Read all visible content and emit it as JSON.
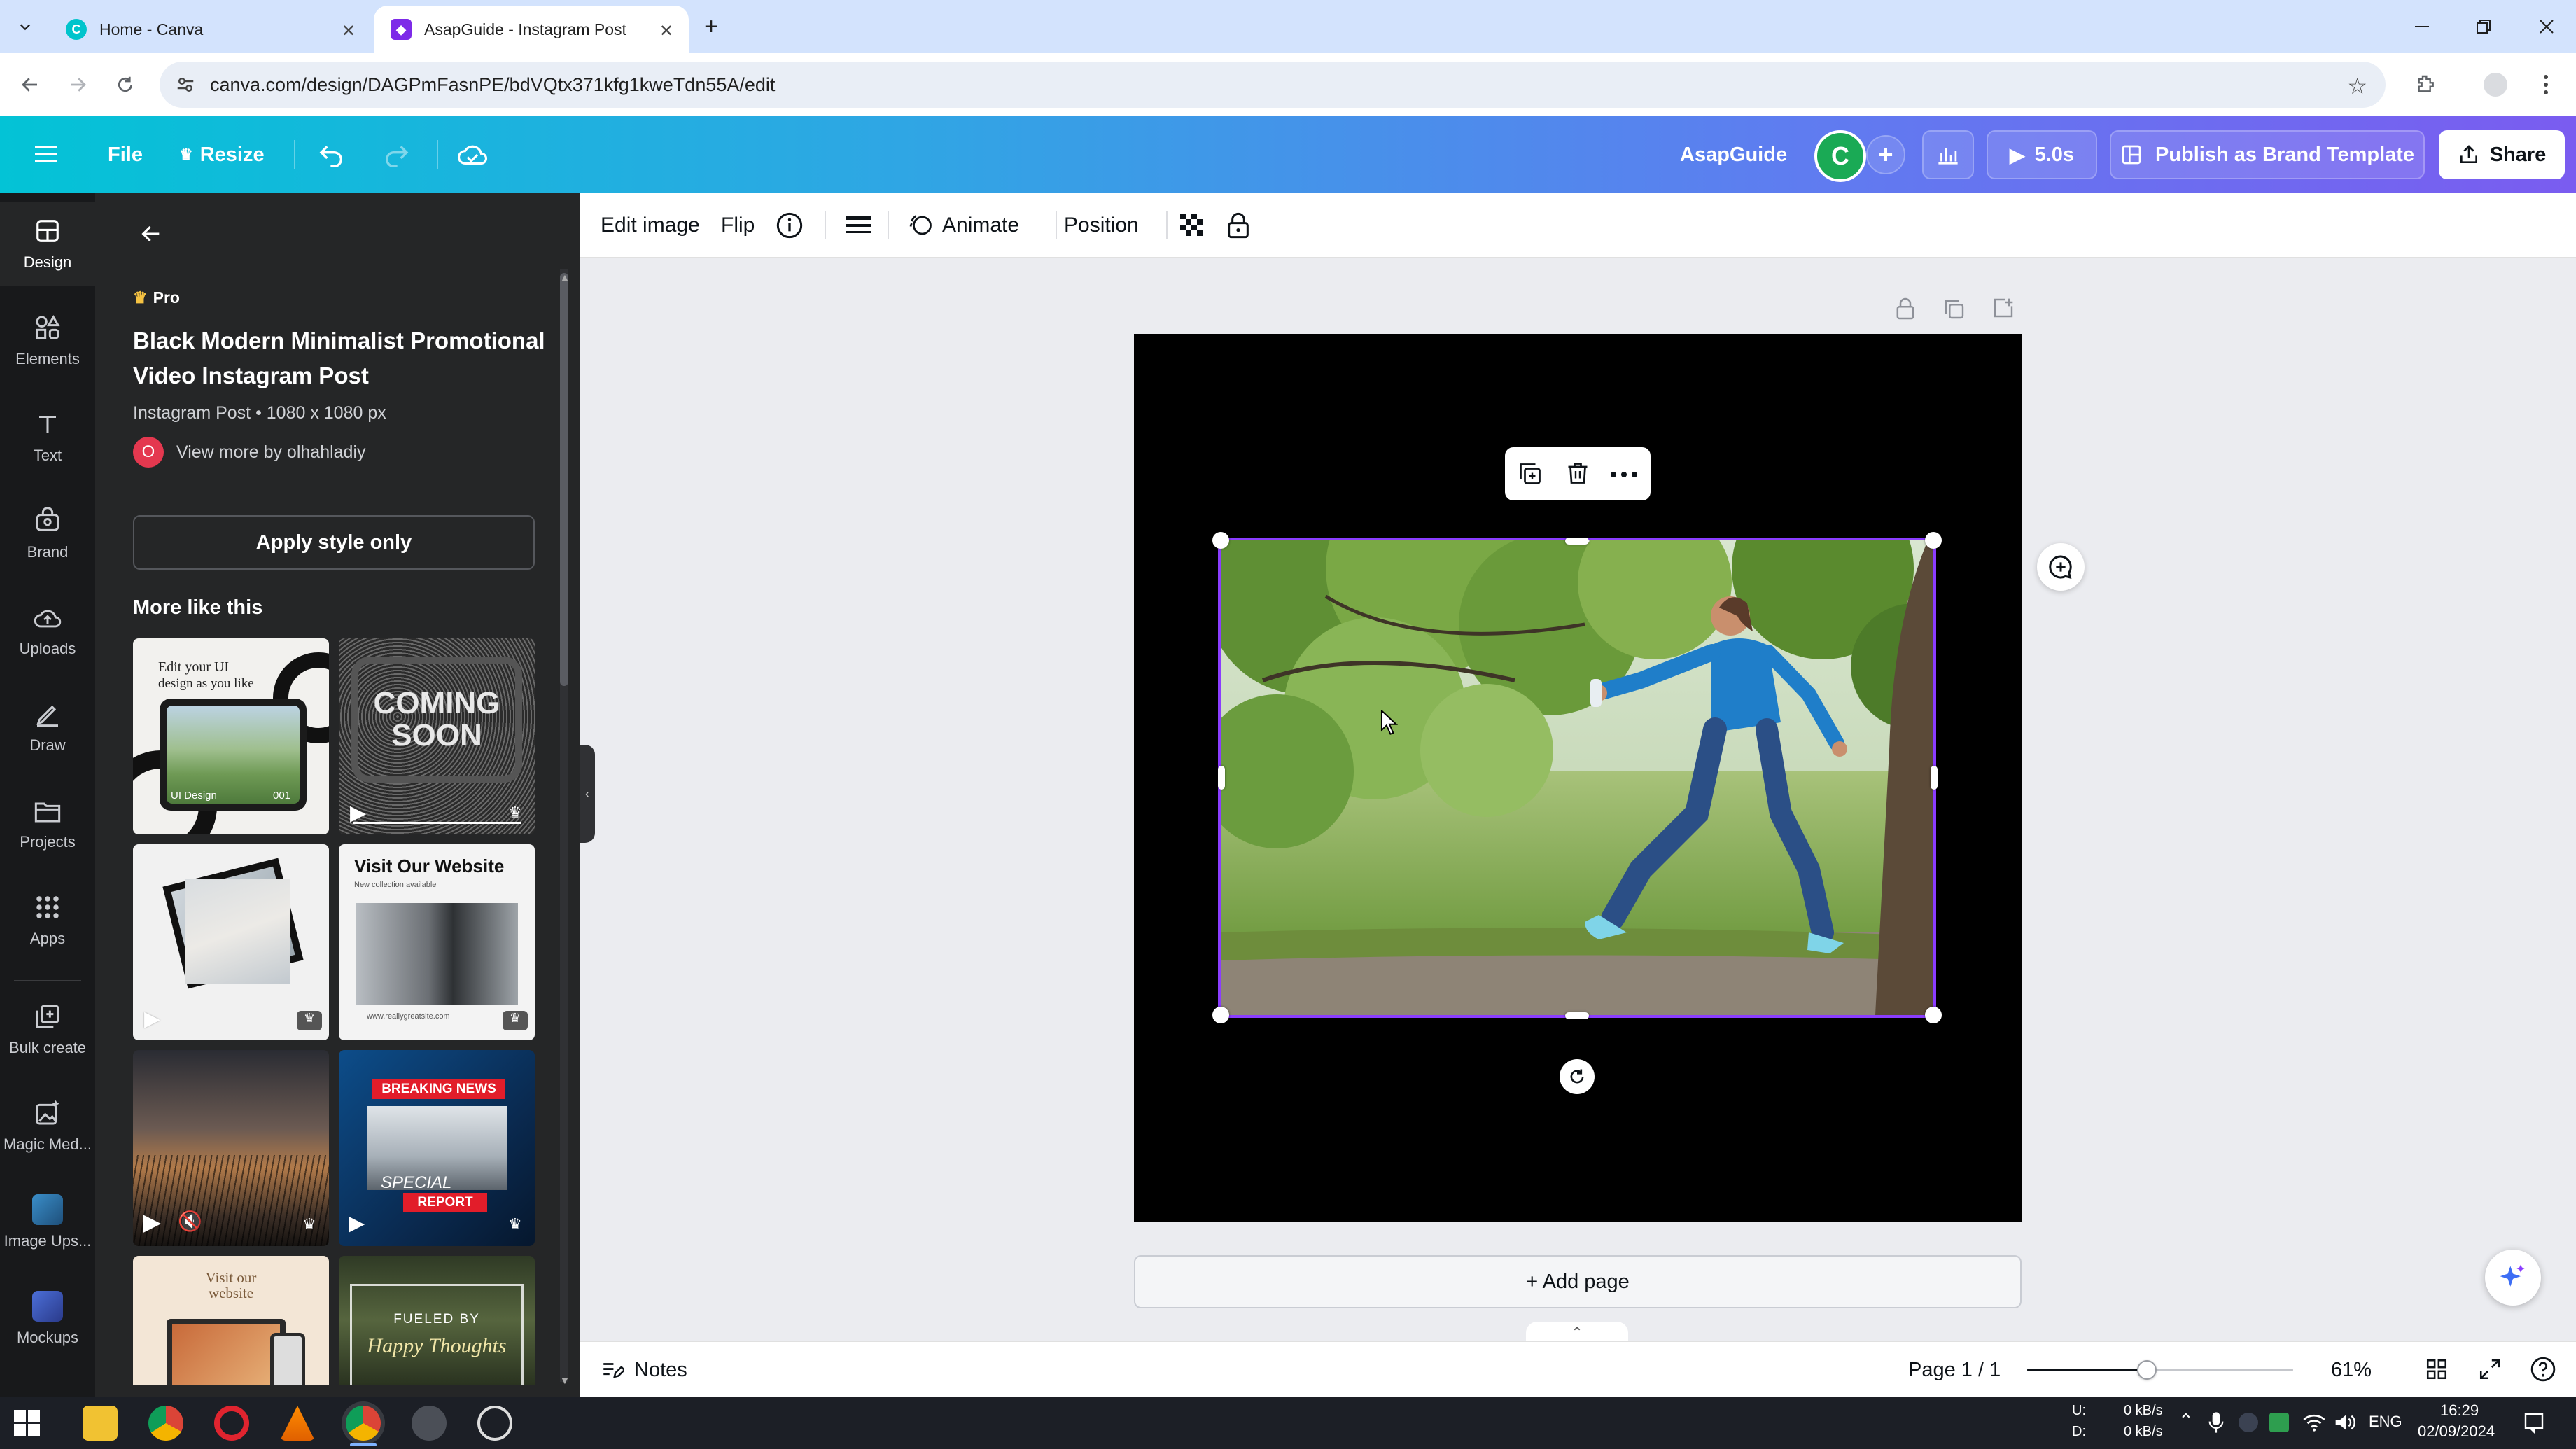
{
  "browser": {
    "tabs": [
      {
        "title": "Home - Canva",
        "active": false
      },
      {
        "title": "AsapGuide - Instagram Post",
        "active": true
      }
    ],
    "url": "canva.com/design/DAGPmFasnPE/bdVQtx371kfg1kweTdn55A/edit"
  },
  "header": {
    "file": "File",
    "resize": "Resize",
    "design_name": "AsapGuide",
    "avatar_letter": "C",
    "play_duration": "5.0s",
    "publish": "Publish as Brand Template",
    "share": "Share"
  },
  "rail": [
    {
      "label": "Design",
      "icon": "design-icon"
    },
    {
      "label": "Elements",
      "icon": "elements-icon"
    },
    {
      "label": "Text",
      "icon": "text-icon"
    },
    {
      "label": "Brand",
      "icon": "brand-icon"
    },
    {
      "label": "Uploads",
      "icon": "uploads-icon"
    },
    {
      "label": "Draw",
      "icon": "draw-icon"
    },
    {
      "label": "Projects",
      "icon": "projects-icon"
    },
    {
      "label": "Apps",
      "icon": "apps-icon"
    },
    {
      "label": "Bulk create",
      "icon": "bulk-create-icon"
    },
    {
      "label": "Magic Med...",
      "icon": "magic-media-icon"
    },
    {
      "label": "Image Ups...",
      "icon": "image-upscaler-icon"
    },
    {
      "label": "Mockups",
      "icon": "mockups-icon"
    }
  ],
  "panel": {
    "badge": "Pro",
    "title": "Black Modern Minimalist Promotional Video Instagram Post",
    "meta": "Instagram Post • 1080 x 1080 px",
    "author_initial": "O",
    "author_link": "View more by olhahladiy",
    "apply_button": "Apply style only",
    "more_heading": "More like this",
    "thumbs": {
      "t1_line1": "Edit your UI",
      "t1_line2": "design as you like",
      "t1_caption": "UI Design",
      "t1_num": "001",
      "t2_text": "COMING SOON",
      "t4_title": "Visit Our Website",
      "t4_sub": "New collection available",
      "t4_url": "www.reallygreatsite.com",
      "t6_top": "BREAKING NEWS",
      "t6_mid": "SPECIAL",
      "t6_bot": "REPORT",
      "t7_text": "Visit our website",
      "t8_top": "FUELED BY",
      "t8_bot": "Happy Thoughts"
    }
  },
  "context_toolbar": {
    "edit_image": "Edit image",
    "flip": "Flip",
    "animate": "Animate",
    "position": "Position"
  },
  "canvas": {
    "add_page": "+ Add page"
  },
  "bottom": {
    "notes": "Notes",
    "page_indicator": "Page 1 / 1",
    "zoom": "61%",
    "zoom_value": 0.45
  },
  "taskbar": {
    "net_up_label": "U:",
    "net_down_label": "D:",
    "net_up": "0 kB/s",
    "net_down": "0 kB/s",
    "lang": "ENG",
    "time": "16:29",
    "date": "02/09/2024"
  },
  "colors": {
    "accent": "#8b3dff",
    "header_start": "#03c3d6",
    "header_end": "#7a5cf0",
    "panel_bg": "#252627",
    "rail_bg": "#18191b"
  }
}
